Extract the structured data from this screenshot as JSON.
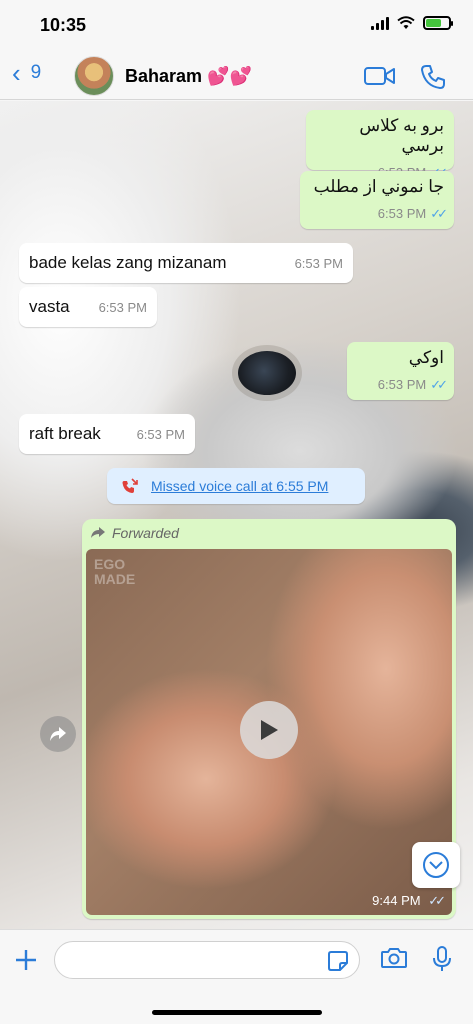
{
  "status": {
    "time": "10:35"
  },
  "header": {
    "back_count": "9",
    "contact_name": "Baharam 💕💕"
  },
  "messages": [
    {
      "text": "برو به کلاس برسي",
      "time": "6:53 PM"
    },
    {
      "text": "جا نموني از مطلب",
      "time": "6:53 PM"
    },
    {
      "text": "bade kelas zang mizanam",
      "time": "6:53 PM"
    },
    {
      "text": "vasta",
      "time": "6:53 PM"
    },
    {
      "text": "اوكي",
      "time": "6:53 PM"
    },
    {
      "text": "raft break",
      "time": "6:53 PM"
    }
  ],
  "missed_call": {
    "text": "Missed voice call at 6:55 PM"
  },
  "media": {
    "forwarded_label": "Forwarded",
    "watermark": "EGO MADE",
    "time": "9:44 PM"
  },
  "colors": {
    "accent": "#2b7cd8",
    "outgoing_bubble": "#dcf8c6",
    "incoming_bubble": "#ffffff",
    "read_ticks": "#4fa3e8",
    "missed_call_icon": "#e0403a"
  },
  "icons": [
    "back-chevron-icon",
    "video-call-icon",
    "phone-icon",
    "missed-call-icon",
    "forward-icon",
    "play-icon",
    "share-icon",
    "scroll-down-icon",
    "plus-icon",
    "sticker-icon",
    "camera-icon",
    "microphone-icon"
  ]
}
